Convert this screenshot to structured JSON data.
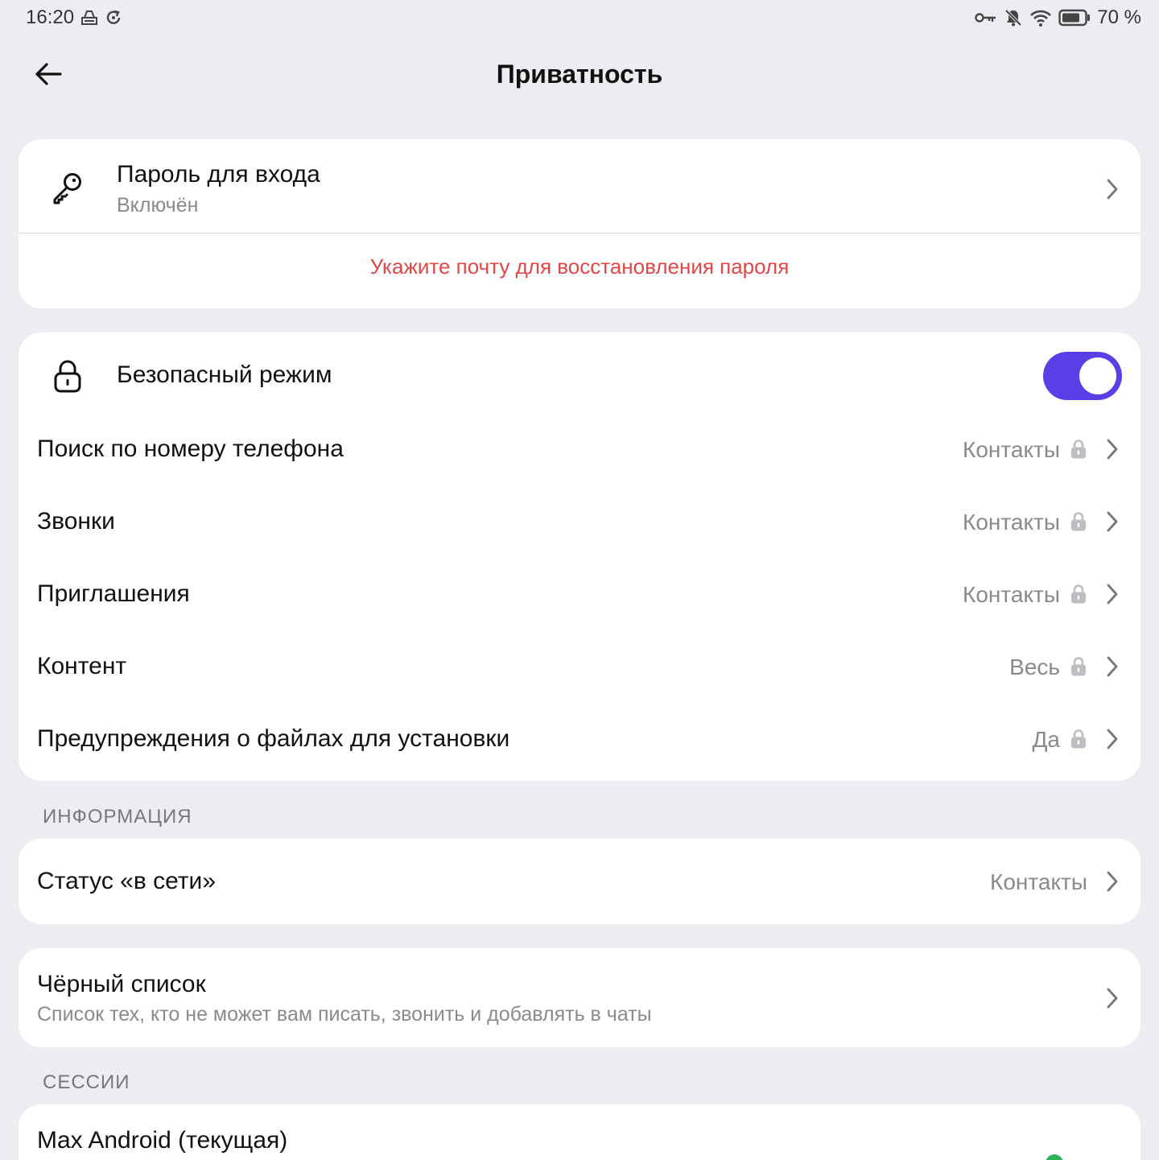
{
  "status_bar": {
    "time": "16:20",
    "battery": "70 %",
    "left_icons": [
      "storage-icon",
      "sync-icon"
    ],
    "right_icons": [
      "vpn-key-icon",
      "bell-off-icon",
      "wifi-icon",
      "battery-icon"
    ]
  },
  "header": {
    "title": "Приватность",
    "back_icon": "arrow-left-icon"
  },
  "password_card": {
    "icon": "key-icon",
    "title": "Пароль для входа",
    "subtitle": "Включён",
    "warning": "Укажите почту для восстановления пароля"
  },
  "safe_card": {
    "safe_mode": {
      "icon": "lock-icon",
      "label": "Безопасный режим",
      "enabled": true
    },
    "rows": [
      {
        "label": "Поиск по номеру телефона",
        "value": "Контакты",
        "locked": true
      },
      {
        "label": "Звонки",
        "value": "Контакты",
        "locked": true
      },
      {
        "label": "Приглашения",
        "value": "Контакты",
        "locked": true
      },
      {
        "label": "Контент",
        "value": "Весь",
        "locked": true
      },
      {
        "label": "Предупреждения о файлах для установки",
        "value": "Да",
        "locked": true
      }
    ]
  },
  "info_section": {
    "label": "ИНФОРМАЦИЯ",
    "online_status": {
      "label": "Статус «в сети»",
      "value": "Контакты"
    }
  },
  "blacklist": {
    "title": "Чёрный список",
    "subtitle": "Список тех, кто не может вам писать, звонить и добавлять в чаты"
  },
  "sessions_section": {
    "label": "СЕССИИ",
    "current": {
      "title": "Max Android (текущая)"
    }
  },
  "colors": {
    "background": "#ededf1",
    "card": "#ffffff",
    "accent": "#5b3fe6",
    "warning": "#e04848",
    "secondary_text": "#8a8a8e",
    "online": "#2fb35a"
  }
}
